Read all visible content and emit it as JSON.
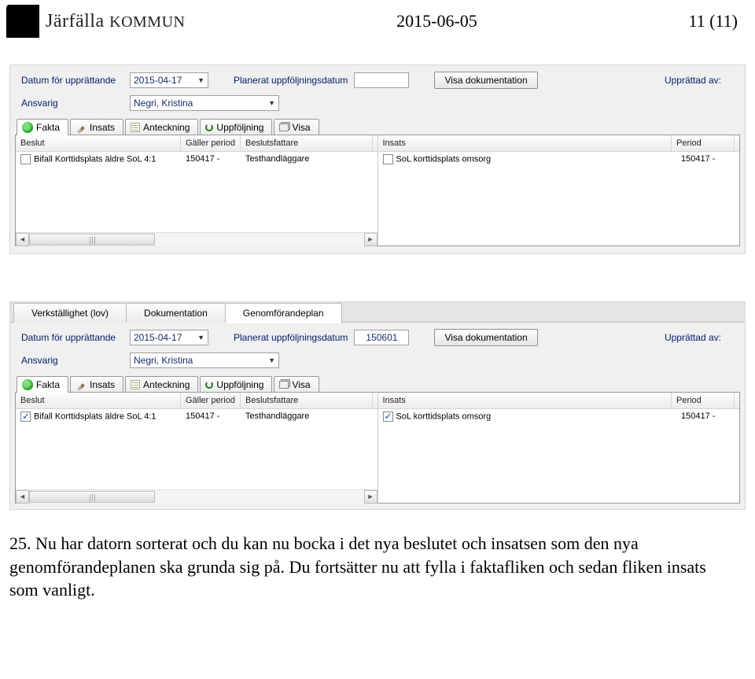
{
  "header": {
    "logo_text_main": "Järfälla",
    "logo_text_suffix": "KOMMUN",
    "date": "2015-06-05",
    "page_indicator": "11 (11)"
  },
  "panel1": {
    "labels": {
      "datum_upprattande": "Datum för upprättande",
      "planerat_uppfoljning": "Planerat uppföljningsdatum",
      "visa_dok": "Visa dokumentation",
      "upprattatav": "Upprättad av:",
      "ansvarig": "Ansvarig"
    },
    "values": {
      "datum": "2015-04-17",
      "ansvarig": "Negri, Kristina",
      "uppfoljning": ""
    },
    "tabs": [
      "Fakta",
      "Insats",
      "Anteckning",
      "Uppföljning",
      "Visa"
    ],
    "columns_left": [
      "Beslut",
      "Gäller period",
      "Beslutsfattare"
    ],
    "columns_right": [
      "Insats",
      "Period"
    ],
    "row_left": {
      "checked": false,
      "beslut": "Bifall Korttidsplats äldre SoL 4:1",
      "galler": "150417 -",
      "bfattare": "Testhandläggare"
    },
    "row_right": {
      "checked": false,
      "insats": "SoL korttidsplats omsorg",
      "period": "150417 -"
    }
  },
  "panel2": {
    "top_tabs": [
      "Verkställighet (lov)",
      "Dokumentation",
      "Genomförandeplan"
    ],
    "labels": {
      "datum_upprattande": "Datum för upprättande",
      "planerat_uppfoljning": "Planerat uppföljningsdatum",
      "visa_dok": "Visa dokumentation",
      "upprattatav": "Upprättad av:",
      "ansvarig": "Ansvarig"
    },
    "values": {
      "datum": "2015-04-17",
      "ansvarig": "Negri, Kristina",
      "uppfoljning": "150601"
    },
    "tabs": [
      "Fakta",
      "Insats",
      "Anteckning",
      "Uppföljning",
      "Visa"
    ],
    "columns_left": [
      "Beslut",
      "Gäller period",
      "Beslutsfattare"
    ],
    "columns_right": [
      "Insats",
      "Period"
    ],
    "row_left": {
      "checked": true,
      "beslut": "Bifall Korttidsplats äldre SoL 4:1",
      "galler": "150417 -",
      "bfattare": "Testhandläggare"
    },
    "row_right": {
      "checked": true,
      "insats": "SoL korttidsplats omsorg",
      "period": "150417 -"
    }
  },
  "body": {
    "num": "25.",
    "text": "Nu har datorn sorterat och du kan nu bocka i det nya beslutet och insatsen som den nya genomförandeplanen ska grunda sig på. Du fortsätter nu att fylla i faktafliken och sedan fliken insats som vanligt."
  }
}
